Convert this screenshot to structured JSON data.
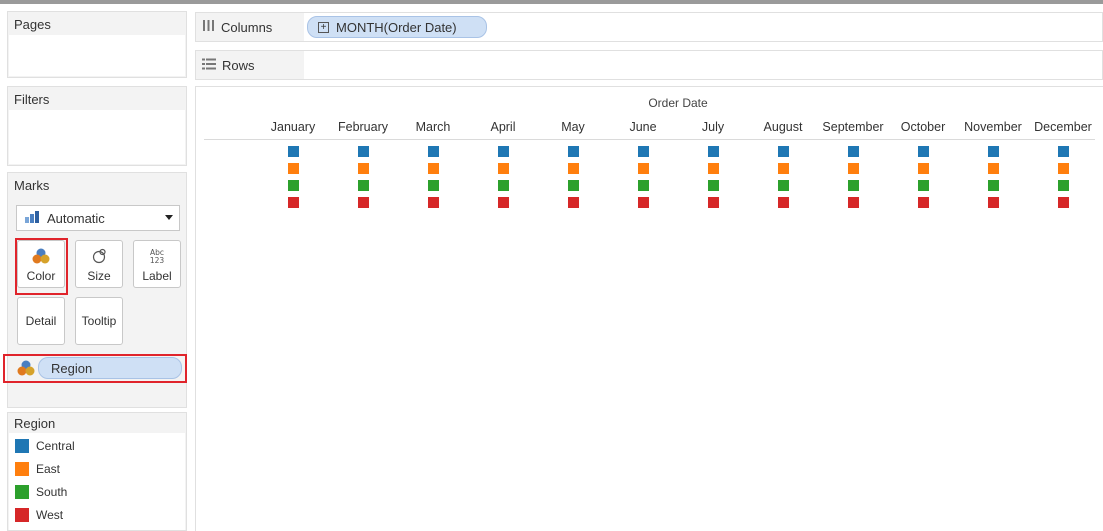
{
  "panels": {
    "pages": {
      "title": "Pages"
    },
    "filters": {
      "title": "Filters"
    },
    "marks": {
      "title": "Marks",
      "type_label": "Automatic",
      "cards": [
        {
          "id": "color",
          "label": "Color",
          "icon": "color-circles-icon"
        },
        {
          "id": "size",
          "label": "Size",
          "icon": "size-icon"
        },
        {
          "id": "label",
          "label": "Label",
          "icon": "abc-123-icon"
        },
        {
          "id": "detail",
          "label": "Detail",
          "icon": "none"
        },
        {
          "id": "tooltip",
          "label": "Tooltip",
          "icon": "none"
        }
      ],
      "color_field": "Region"
    }
  },
  "legend": {
    "title": "Region",
    "items": [
      {
        "label": "Central",
        "color": "#1f77b4"
      },
      {
        "label": "East",
        "color": "#ff7f0e"
      },
      {
        "label": "South",
        "color": "#2ca02c"
      },
      {
        "label": "West",
        "color": "#d62728"
      }
    ]
  },
  "shelves": {
    "columns": {
      "label": "Columns",
      "pill": "MONTH(Order Date)",
      "pill_icon": "plus-expand-icon"
    },
    "rows": {
      "label": "Rows"
    }
  },
  "view": {
    "header_title": "Order Date",
    "months": [
      "January",
      "February",
      "March",
      "April",
      "May",
      "June",
      "July",
      "August",
      "September",
      "October",
      "November",
      "December"
    ],
    "regions": [
      "Central",
      "East",
      "South",
      "West"
    ]
  },
  "colors": {
    "pill_fill": "#cfe0f5",
    "highlight": "#e0242b"
  }
}
